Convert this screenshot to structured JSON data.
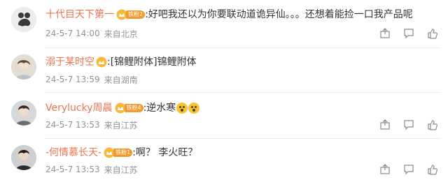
{
  "comments": [
    {
      "username": "十代目天下第一",
      "badge": "铁粉2",
      "text": ":好吧我还以为你要联动道诡异仙。。。还想着能捡一口我产品呢",
      "date": "24-5-7 14:00",
      "location": "来自北京",
      "has_emoji": false
    },
    {
      "username": "溺于某时空",
      "badge": "",
      "text": ":[锦鲤附体]锦鲤附体",
      "date": "24-5-7 13:59",
      "location": "来自湖南",
      "has_emoji": false
    },
    {
      "username": "Verylucky周晨",
      "badge": "铁粉4",
      "text": ":逆水寒",
      "date": "24-5-7 13:53",
      "location": "来自江苏",
      "has_emoji": true
    },
    {
      "username": "-何情慕长天-",
      "badge": "铁粉1",
      "text": ":啊？ 李火旺？",
      "date": "24-5-7 13:53",
      "location": "来自江苏",
      "has_emoji": false
    }
  ],
  "icons": {
    "share": "share-icon",
    "reply": "comment-icon",
    "like": "thumbs-up-icon"
  },
  "colors": {
    "username": "#eb7350",
    "badge": "#f29a2e",
    "meta": "#939393"
  }
}
